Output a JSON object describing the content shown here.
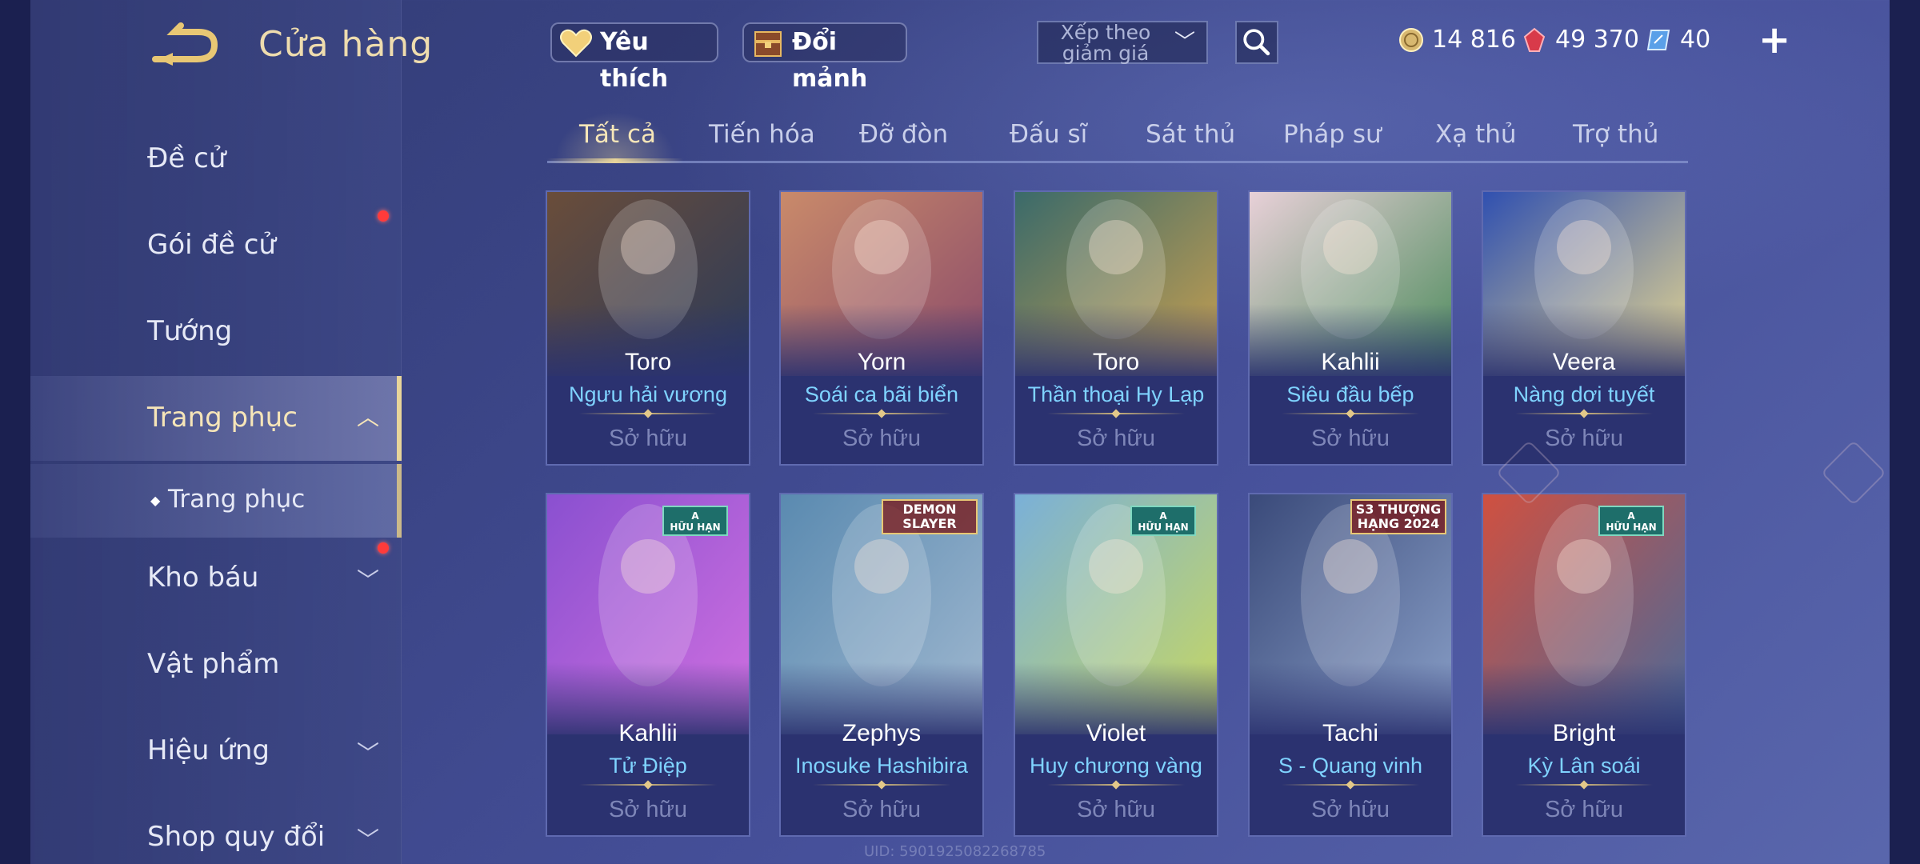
{
  "header": {
    "title": "Cửa hàng"
  },
  "top": {
    "favorites_label": "Yêu thích",
    "exchange_label": "Đổi mảnh",
    "sort_label": "Xếp theo giảm giá",
    "currencies": [
      {
        "icon": "gold-coin-icon",
        "value": "14 816"
      },
      {
        "icon": "red-ruby-icon",
        "value": "49 370"
      },
      {
        "icon": "voucher-icon",
        "value": "40"
      }
    ]
  },
  "sidebar": {
    "items": [
      {
        "label": "Đề cử"
      },
      {
        "label": "Gói đề cử"
      },
      {
        "label": "Tướng"
      },
      {
        "label": "Trang phục"
      },
      {
        "label": "Trang phục"
      },
      {
        "label": "Kho báu"
      },
      {
        "label": "Vật phẩm"
      },
      {
        "label": "Hiệu ứng"
      },
      {
        "label": "Shop quy đổi"
      }
    ]
  },
  "tabs": [
    "Tất cả",
    "Tiến hóa",
    "Đỡ đòn",
    "Đấu sĩ",
    "Sát thủ",
    "Pháp sư",
    "Xạ thủ",
    "Trợ thủ"
  ],
  "cards": [
    {
      "hero": "Toro",
      "skin": "Ngưu hải vương",
      "status": "Sở hữu",
      "c1": "#6a4d3a",
      "c2": "#2a3a5a"
    },
    {
      "hero": "Yorn",
      "skin": "Soái ca bãi biển",
      "status": "Sở hữu",
      "c1": "#c98a6a",
      "c2": "#8a4a6a"
    },
    {
      "hero": "Toro",
      "skin": "Thần thoại Hy Lạp",
      "status": "Sở hữu",
      "c1": "#3a6a6a",
      "c2": "#c9a050"
    },
    {
      "hero": "Kahlii",
      "skin": "Siêu đầu bếp",
      "status": "Sở hữu",
      "c1": "#e8d0d8",
      "c2": "#4a8a5a"
    },
    {
      "hero": "Veera",
      "skin": "Nàng dơi tuyết",
      "status": "Sở hữu",
      "c1": "#3050b0",
      "c2": "#e8d890"
    },
    {
      "hero": "Kahlii",
      "skin": "Tử Điệp",
      "status": "Sở hữu",
      "c1": "#8a50d0",
      "c2": "#d070e0",
      "badge": "A\nHỮU HẠN"
    },
    {
      "hero": "Zephys",
      "skin": "Inosuke Hashibira",
      "status": "Sở hữu",
      "c1": "#5a8ab0",
      "c2": "#a0b8d0",
      "badge_logo": "DEMON SLAYER"
    },
    {
      "hero": "Violet",
      "skin": "Huy chương vàng",
      "status": "Sở hữu",
      "c1": "#7ab0d8",
      "c2": "#c8d860",
      "badge": "A\nHỮU HẠN"
    },
    {
      "hero": "Tachi",
      "skin": "S - Quang vinh",
      "status": "Sở hữu",
      "c1": "#3a4a7a",
      "c2": "#8aa0c8",
      "badge_logo": "S3 THƯỢNG HẠNG 2024"
    },
    {
      "hero": "Bright",
      "skin": "Kỳ Lân soái",
      "status": "Sở hữu",
      "c1": "#d05040",
      "c2": "#4a6a9a",
      "badge": "A\nHỮU HẠN"
    }
  ],
  "footer": {
    "uid": "UID: 5901925082268785"
  }
}
